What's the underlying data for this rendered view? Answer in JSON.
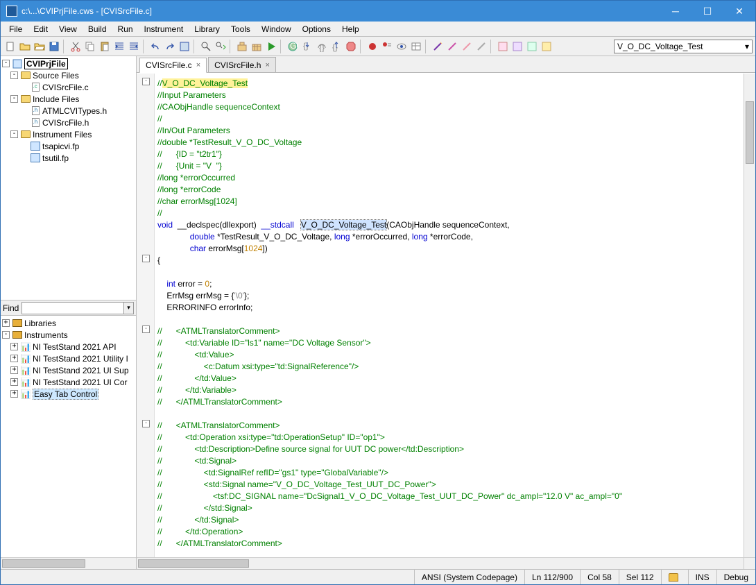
{
  "titlebar": {
    "text": "c:\\...\\CVIPrjFile.cws - [CVISrcFile.c]"
  },
  "menus": [
    "File",
    "Edit",
    "View",
    "Build",
    "Run",
    "Instrument",
    "Library",
    "Tools",
    "Window",
    "Options",
    "Help"
  ],
  "func_combo": "V_O_DC_Voltage_Test",
  "project": {
    "root": "CVIPrjFile",
    "groups": [
      {
        "name": "Source Files",
        "items": [
          "CVISrcFile.c"
        ]
      },
      {
        "name": "Include Files",
        "items": [
          "ATMLCVITypes.h",
          "CVISrcFile.h"
        ]
      },
      {
        "name": "Instrument Files",
        "items": [
          "tsapicvi.fp",
          "tsutil.fp"
        ]
      }
    ]
  },
  "find_label": "Find",
  "libraries": {
    "root1": "Libraries",
    "root2": "Instruments",
    "items": [
      "NI TestStand 2021 API",
      "NI TestStand 2021 Utility I",
      "NI TestStand 2021 UI Sup",
      "NI TestStand 2021 UI Cor",
      "Easy Tab Control"
    ]
  },
  "tabs": [
    {
      "name": "CVISrcFile.c",
      "active": true
    },
    {
      "name": "CVISrcFile.h",
      "active": false
    }
  ],
  "status": {
    "encoding": "ANSI (System Codepage)",
    "pos": "Ln 112/900",
    "col": "Col 58",
    "sel": "Sel 112",
    "ins": "INS",
    "mode": "Debug"
  },
  "code_lines": [
    {
      "t": "//",
      "h": "V_O_DC_Voltage_Test",
      "hl": "y"
    },
    {
      "t": "//Input Parameters"
    },
    {
      "t": "//CAObjHandle sequenceContext"
    },
    {
      "t": "//"
    },
    {
      "t": "//In/Out Parameters"
    },
    {
      "t": "//double *TestResult_V_O_DC_Voltage"
    },
    {
      "t": "//      {ID = \"t2tr1\"}"
    },
    {
      "t": "//      {Unit = \"V  \"}"
    },
    {
      "t": "//long *errorOccurred"
    },
    {
      "t": "//long *errorCode"
    },
    {
      "t": "//char errorMsg[1024]"
    },
    {
      "t": "//"
    },
    {
      "sig": true
    },
    {
      "sig2": true
    },
    {
      "sig3": true
    },
    {
      "brace": "{"
    },
    {
      "blank": true
    },
    {
      "loc1": true
    },
    {
      "loc2": true
    },
    {
      "loc3": true
    },
    {
      "blank": true
    },
    {
      "t": "//      <ATMLTranslatorComment>"
    },
    {
      "t": "//          <td:Variable ID=\"ls1\" name=\"DC Voltage Sensor\">"
    },
    {
      "t": "//              <td:Value>"
    },
    {
      "t": "//                  <c:Datum xsi:type=\"td:SignalReference\"/>"
    },
    {
      "t": "//              </td:Value>"
    },
    {
      "t": "//          </td:Variable>"
    },
    {
      "t": "//      </ATMLTranslatorComment>"
    },
    {
      "blank": true
    },
    {
      "t": "//      <ATMLTranslatorComment>"
    },
    {
      "t": "//          <td:Operation xsi:type=\"td:OperationSetup\" ID=\"op1\">"
    },
    {
      "t": "//              <td:Description>Define source signal for UUT DC power</td:Description>"
    },
    {
      "t": "//              <td:Signal>"
    },
    {
      "t": "//                  <td:SignalRef refID=\"gs1\" type=\"GlobalVariable\"/>"
    },
    {
      "t": "//                  <std:Signal name=\"V_O_DC_Voltage_Test_UUT_DC_Power\">"
    },
    {
      "t": "//                      <tsf:DC_SIGNAL name=\"DcSignal1_V_O_DC_Voltage_Test_UUT_DC_Power\" dc_ampl=\"12.0 V\" ac_ampl=\"0\""
    },
    {
      "t": "//                  </std:Signal>"
    },
    {
      "t": "//              </td:Signal>"
    },
    {
      "t": "//          </td:Operation>"
    },
    {
      "t": "//      </ATMLTranslatorComment>"
    }
  ]
}
